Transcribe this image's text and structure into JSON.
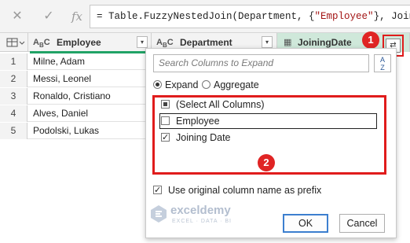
{
  "formula_bar": {
    "cancel_icon": "close-icon",
    "confirm_icon": "check-icon",
    "fx_label": "fx",
    "formula_prefix": "= Table.FuzzyNestedJoin(Department, {",
    "formula_string": "\"Employee\"",
    "formula_suffix": "}, JoiningDat"
  },
  "grid": {
    "columns": [
      {
        "type": "ABC",
        "label": "Employee"
      },
      {
        "type": "ABC",
        "label": "Department"
      },
      {
        "type": "",
        "label": "JoiningDate"
      }
    ],
    "rows": [
      {
        "num": "1",
        "employee": "Milne, Adam"
      },
      {
        "num": "2",
        "employee": "Messi, Leonel"
      },
      {
        "num": "3",
        "employee": "Ronaldo, Cristiano"
      },
      {
        "num": "4",
        "employee": "Alves, Daniel"
      },
      {
        "num": "5",
        "employee": "Podolski, Lukas"
      }
    ]
  },
  "expand_panel": {
    "search_placeholder": "Search Columns to Expand",
    "sort_label_top": "A",
    "sort_label_bottom": "Z",
    "mode_expand": "Expand",
    "mode_aggregate": "Aggregate",
    "selected_mode": "Expand",
    "columns": [
      {
        "label": "(Select All Columns)",
        "state": "indeterminate"
      },
      {
        "label": "Employee",
        "state": "unchecked"
      },
      {
        "label": "Joining Date",
        "state": "checked"
      }
    ],
    "prefix_label": "Use original column name as prefix",
    "prefix_checked": true,
    "ok_label": "OK",
    "cancel_label": "Cancel"
  },
  "watermark": {
    "brand": "exceldemy",
    "tagline": "EXCEL · DATA · BI"
  },
  "annotations": {
    "step1": "1",
    "step2": "2"
  },
  "colors": {
    "accent_green": "#21a366",
    "callout_red": "#e02424",
    "ok_border": "#3c7fcf"
  }
}
